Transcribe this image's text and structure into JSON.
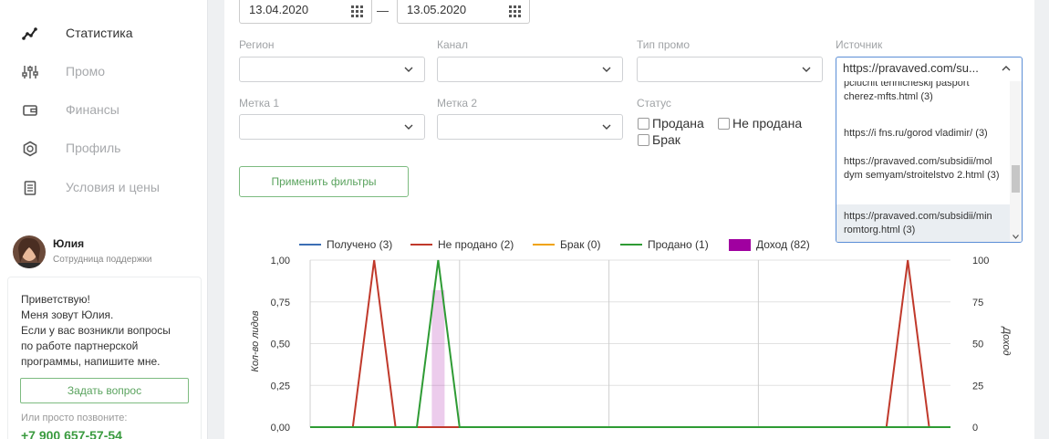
{
  "nav": {
    "items": [
      {
        "label": "Статистика",
        "icon": "chart-line-icon",
        "active": true
      },
      {
        "label": "Промо",
        "icon": "sliders-icon",
        "active": false
      },
      {
        "label": "Финансы",
        "icon": "wallet-icon",
        "active": false
      },
      {
        "label": "Профиль",
        "icon": "gear-icon",
        "active": false
      },
      {
        "label": "Условия и цены",
        "icon": "document-icon",
        "active": false
      }
    ]
  },
  "support": {
    "name": "Юлия",
    "role": "Сотрудница поддержки",
    "message": "Приветствую!\nМеня зовут Юлия.\nЕсли у вас возникли вопросы\nпо работе партнерской\nпрограммы, напишите мне.",
    "ask_button": "Задать вопрос",
    "call_label": "Или просто позвоните:",
    "phone": "+7 900 657-57-54"
  },
  "filters": {
    "date_from": "13.04.2020",
    "date_to": "13.05.2020",
    "date_separator": "—",
    "region_label": "Регион",
    "channel_label": "Канал",
    "promo_type_label": "Тип промо",
    "source_label": "Источник",
    "tag1_label": "Метка 1",
    "tag2_label": "Метка 2",
    "status_label": "Статус",
    "status_options": [
      "Продана",
      "Не продана",
      "Брак"
    ],
    "apply_button": "Применить фильтры"
  },
  "source_dropdown": {
    "selected": "https://pravaved.com/su...",
    "options": [
      "pcluchit tehnicheskij pasport cherez-mfts.html (3)",
      "https://i fns.ru/gorod vladimir/ (3)",
      "https://pravaved.com/subsidii/mol dym semyam/stroitelstvo 2.html (3)",
      "https://pravaved.com/subsidii/min romtorg.html (3)"
    ]
  },
  "colors": {
    "received": "#3c6eb4",
    "not_sold": "#c0392b",
    "defect": "#f0a30a",
    "sold": "#2e9b34",
    "income": "#a000a0",
    "accent_green": "#3a9b3f"
  },
  "chart_data": {
    "type": "line",
    "legend": [
      "Получено (3)",
      "Не продано (2)",
      "Брак (0)",
      "Продано (1)",
      "Доход (82)"
    ],
    "ylabel": "Кол-во лидов",
    "y2label": "Доход",
    "ylim": [
      0,
      1
    ],
    "y2lim": [
      0,
      100
    ],
    "yticks": [
      "0,00",
      "0,25",
      "0,50",
      "0,75",
      "1,00"
    ],
    "y2ticks": [
      "0",
      "25",
      "50",
      "75",
      "100"
    ],
    "x": [
      0,
      1,
      2,
      3,
      4,
      5,
      6,
      7,
      8,
      9,
      10,
      11,
      12,
      13,
      14,
      15,
      16,
      17,
      18,
      19,
      20,
      21,
      22,
      23,
      24,
      25,
      26,
      27,
      28,
      29,
      30
    ],
    "series": [
      {
        "name": "Получено (3)",
        "values": [
          0,
          0,
          0,
          0,
          0,
          0,
          0,
          0,
          0,
          0,
          0,
          0,
          0,
          0,
          0,
          0,
          0,
          0,
          0,
          0,
          0,
          0,
          0,
          0,
          0,
          0,
          0,
          0,
          0,
          0,
          0
        ]
      },
      {
        "name": "Не продано (2)",
        "values": [
          0,
          0,
          0,
          1,
          0,
          0,
          0,
          0,
          0,
          0,
          0,
          0,
          0,
          0,
          0,
          0,
          0,
          0,
          0,
          0,
          0,
          0,
          0,
          0,
          0,
          0,
          0,
          0,
          1,
          0,
          0
        ]
      },
      {
        "name": "Брак (0)",
        "values": [
          0,
          0,
          0,
          0,
          0,
          0,
          0,
          0,
          0,
          0,
          0,
          0,
          0,
          0,
          0,
          0,
          0,
          0,
          0,
          0,
          0,
          0,
          0,
          0,
          0,
          0,
          0,
          0,
          0,
          0,
          0
        ]
      },
      {
        "name": "Продано (1)",
        "values": [
          0,
          0,
          0,
          0,
          0,
          0,
          1,
          0,
          0,
          0,
          0,
          0,
          0,
          0,
          0,
          0,
          0,
          0,
          0,
          0,
          0,
          0,
          0,
          0,
          0,
          0,
          0,
          0,
          0,
          0,
          0
        ]
      },
      {
        "name": "Доход (82)",
        "type": "bar",
        "axis": "right",
        "values": [
          0,
          0,
          0,
          0,
          0,
          0,
          82,
          0,
          0,
          0,
          0,
          0,
          0,
          0,
          0,
          0,
          0,
          0,
          0,
          0,
          0,
          0,
          0,
          0,
          0,
          0,
          0,
          0,
          0,
          0,
          0
        ]
      }
    ]
  }
}
